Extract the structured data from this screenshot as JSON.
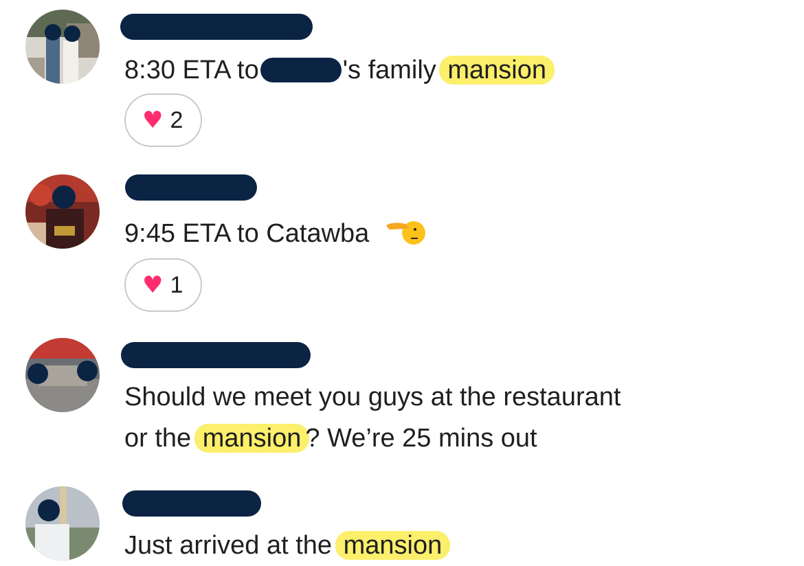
{
  "messages": [
    {
      "text_parts": [
        "8:30 ETA to",
        "'s family",
        "mansion"
      ],
      "reaction": {
        "icon": "heart-icon",
        "count": "2"
      }
    },
    {
      "text": "9:45 ETA to Catawba",
      "emoji": "saluting-face-emoji",
      "reaction": {
        "icon": "heart-icon",
        "count": "1"
      }
    },
    {
      "line1": "Should we meet you guys at the restaurant",
      "line2_parts": [
        "or the",
        "mansion",
        "? We’re 25 mins out"
      ]
    },
    {
      "text_parts": [
        "Just arrived at the",
        "mansion"
      ]
    }
  ],
  "colors": {
    "highlight": "#fbef6b",
    "redaction": "#0b2444",
    "heart": "#ff2d6f"
  }
}
